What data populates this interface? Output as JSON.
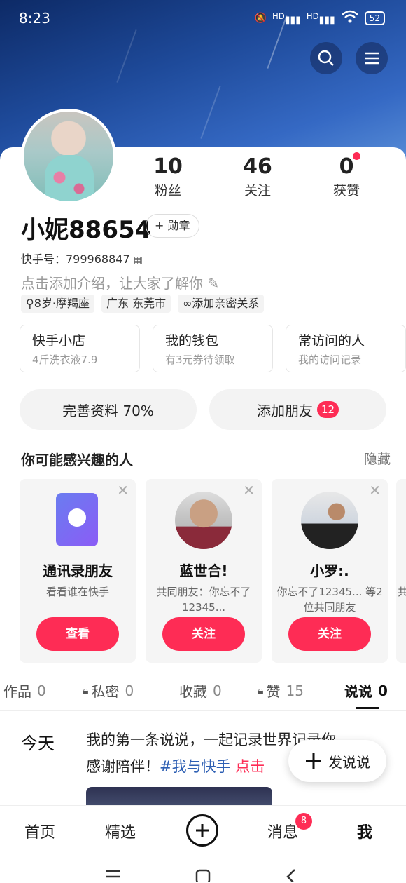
{
  "status": {
    "time": "8:23",
    "battery": "52",
    "signal1": "HD",
    "signal2": "HD"
  },
  "profile": {
    "name": "小妮88654",
    "medal_label": "+ 勋章",
    "kuaishou_id": "快手号：799968847",
    "intro_placeholder": "点击添加介绍，让大家了解你",
    "tags": [
      "8岁·摩羯座",
      "广东 东莞市",
      "添加亲密关系"
    ]
  },
  "stats": [
    {
      "value": "10",
      "label": "粉丝"
    },
    {
      "value": "46",
      "label": "关注"
    },
    {
      "value": "0",
      "label": "获赞"
    }
  ],
  "services": [
    {
      "title": "快手小店",
      "subtitle": "4斤洗衣液7.9"
    },
    {
      "title": "我的钱包",
      "subtitle": "有3元券待领取"
    },
    {
      "title": "常访问的人",
      "subtitle": "我的访问记录"
    }
  ],
  "actions": {
    "complete_profile": "完善资料 70%",
    "add_friend": "添加朋友",
    "add_friend_badge": "12"
  },
  "recommend": {
    "title": "你可能感兴趣的人",
    "hide": "隐藏",
    "cards": [
      {
        "name": "通讯录朋友",
        "desc": "看看谁在快手",
        "button": "查看"
      },
      {
        "name": "蓝世合!",
        "desc": "共同朋友：你忘不了12345...",
        "button": "关注"
      },
      {
        "name": "小罗:.",
        "desc": "你忘不了12345... 等2位共同朋友",
        "button": "关注"
      },
      {
        "name": "",
        "desc": "共",
        "button": ""
      }
    ]
  },
  "tabs": [
    {
      "label": "作品",
      "count": "0"
    },
    {
      "label": "私密",
      "count": "0"
    },
    {
      "label": "收藏",
      "count": "0"
    },
    {
      "label": "赞",
      "count": "15"
    },
    {
      "label": "说说",
      "count": "0"
    }
  ],
  "feed": {
    "day": "今天",
    "text": "我的第一条说说，一起记录世界记录你",
    "text2": "感谢陪伴！",
    "hashtag": "#我与快手",
    "more": "点击",
    "fab_label": "发说说"
  },
  "nav": {
    "home": "首页",
    "featured": "精选",
    "messages": "消息",
    "messages_badge": "8",
    "me": "我"
  }
}
